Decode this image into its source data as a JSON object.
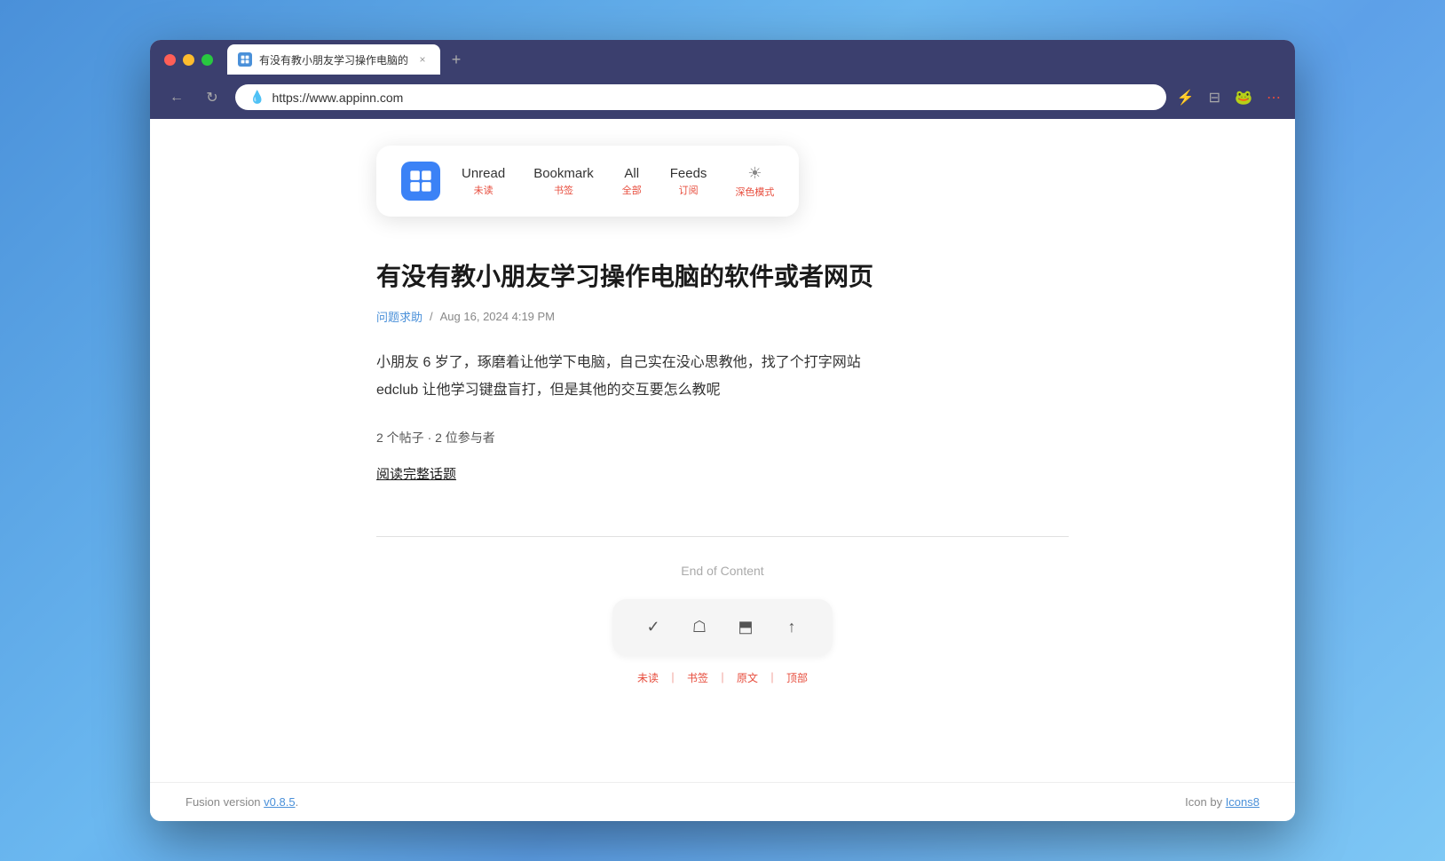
{
  "browser": {
    "tab_title": "有没有教小朋友学习操作电脑的",
    "tab_close": "×",
    "new_tab": "+",
    "url": "https://www.appinn.com",
    "back_icon": "←",
    "refresh_icon": "↻"
  },
  "nav": {
    "logo_alt": "Fusion logo",
    "unread_label": "Unread",
    "unread_cn": "未读",
    "bookmark_label": "Bookmark",
    "bookmark_cn": "书签",
    "all_label": "All",
    "all_cn": "全部",
    "feeds_label": "Feeds",
    "feeds_cn": "订阅",
    "darkmode_icon": "☀",
    "darkmode_cn": "深色模式"
  },
  "article": {
    "title": "有没有教小朋友学习操作电脑的软件或者网页",
    "category": "问题求助",
    "date": "Aug 16, 2024 4:19 PM",
    "body_line1": "小朋友 6 岁了，琢磨着让他学下电脑，自己实在没心思教他，找了个打字网站",
    "body_line2": "edclub 让他学习键盘盲打，但是其他的交互要怎么教呢",
    "stats": "2 个帖子 · 2 位参与者",
    "read_link": "阅读完整话题",
    "end_of_content": "End of Content"
  },
  "action_bar": {
    "check_icon": "✓",
    "bookmark_icon": "☖",
    "open_icon": "⬒",
    "top_icon": "↑",
    "label_unread": "未读",
    "label_bookmark": "书签",
    "label_original": "原文",
    "label_top": "顶部",
    "sep": "｜"
  },
  "footer": {
    "version_text": "Fusion version ",
    "version_link": "v0.8.5",
    "version_suffix": ".",
    "icon_text": "Icon by ",
    "icon_link": "Icons8"
  }
}
